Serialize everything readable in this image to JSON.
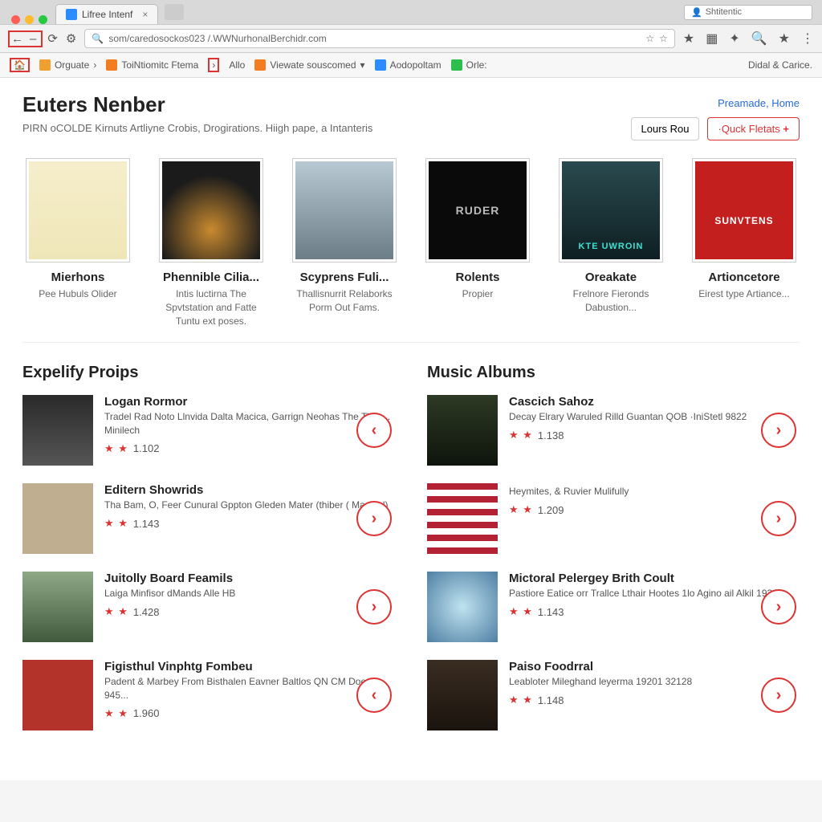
{
  "browser": {
    "tab_title": "Lifree Intenf",
    "auth_chip": "Shtitentic",
    "url": "som/caredosockos023 /.WWNurhonalBerchidr.com",
    "bookmarks": {
      "b1": "Orguate",
      "b2": "ToiNtiomitc Ftema",
      "b3": "Allo",
      "b4": "Viewate souscomed",
      "b5": "Aodopoltam",
      "b6": "Orle:",
      "right": "Didal & Carice."
    }
  },
  "page": {
    "title": "Euters Nenber",
    "subtitle": "PIRN oCOLDE Kirnuts Artliyne Crobis, Drogirations. Hiigh pape, a Intanteris",
    "header_link": "Preamade, Home",
    "btn1": "Lours Rou",
    "btn2": "·Quck Fletats"
  },
  "featured": [
    {
      "title": "Mierhons",
      "sub": "Pee Hubuls Olider"
    },
    {
      "title": "Phennible Cilia...",
      "sub": "Intis luctirna The Spvtstation and Fatte Tuntu ext poses."
    },
    {
      "title": "Scyprens Fuli...",
      "sub": "Thallisnurrit Relaborks Porm Out Fams."
    },
    {
      "title": "Rolents",
      "sub": "Propier",
      "badge": "RUDER"
    },
    {
      "title": "Oreakate",
      "sub": "Frelnore Fieronds Dabustion..."
    },
    {
      "title": "Artioncetore",
      "sub": "Eirest type Artiance..."
    }
  ],
  "left": {
    "heading": "Expelify Proips",
    "items": [
      {
        "title": "Logan Rormor",
        "sub": "Tradel Rad Noto Llnvida Dalta Macica, Garrign Neohas The Time... Minilech",
        "rating": "1.102",
        "arrow": "left"
      },
      {
        "title": "Editern Showrids",
        "sub": "Tha Bam, O, Feer Cunural Gppton Gleden Mater (thiber ( Manisol)",
        "rating": "1.143",
        "arrow": "right"
      },
      {
        "title": "Juitolly Board Feamils",
        "sub": "Laiga Minfisor dMands Alle HB",
        "rating": "1.428",
        "arrow": "right"
      },
      {
        "title": "Figisthul Vinphtg Fombeu",
        "sub": "Padent & Marbey From Bisthalen Eavner Baltlos QN CM Doeche 945...",
        "rating": "1.960",
        "arrow": "left"
      }
    ]
  },
  "right": {
    "heading": "Music Albums",
    "items": [
      {
        "title": "Cascich Sahoz",
        "sub": "Decay Elrary Waruled Rilld Guantan QOB ·IniStetl 9822",
        "rating": "1.138",
        "arrow": "right"
      },
      {
        "title": "",
        "sub": "Heymites, & Ruvier Mulifully",
        "rating": "1.209",
        "arrow": "right"
      },
      {
        "title": "Mictoral Pelergey Brith Coult",
        "sub": "Pastiore Eatice orr Trallce Lthair Hootes 1lo Agino ail Alkil 1931",
        "rating": "1.143",
        "arrow": "right"
      },
      {
        "title": "Paiso Foodrral",
        "sub": "Leabloter Mileghand leyerma 19201 32128",
        "rating": "1.148",
        "arrow": "right"
      }
    ]
  }
}
